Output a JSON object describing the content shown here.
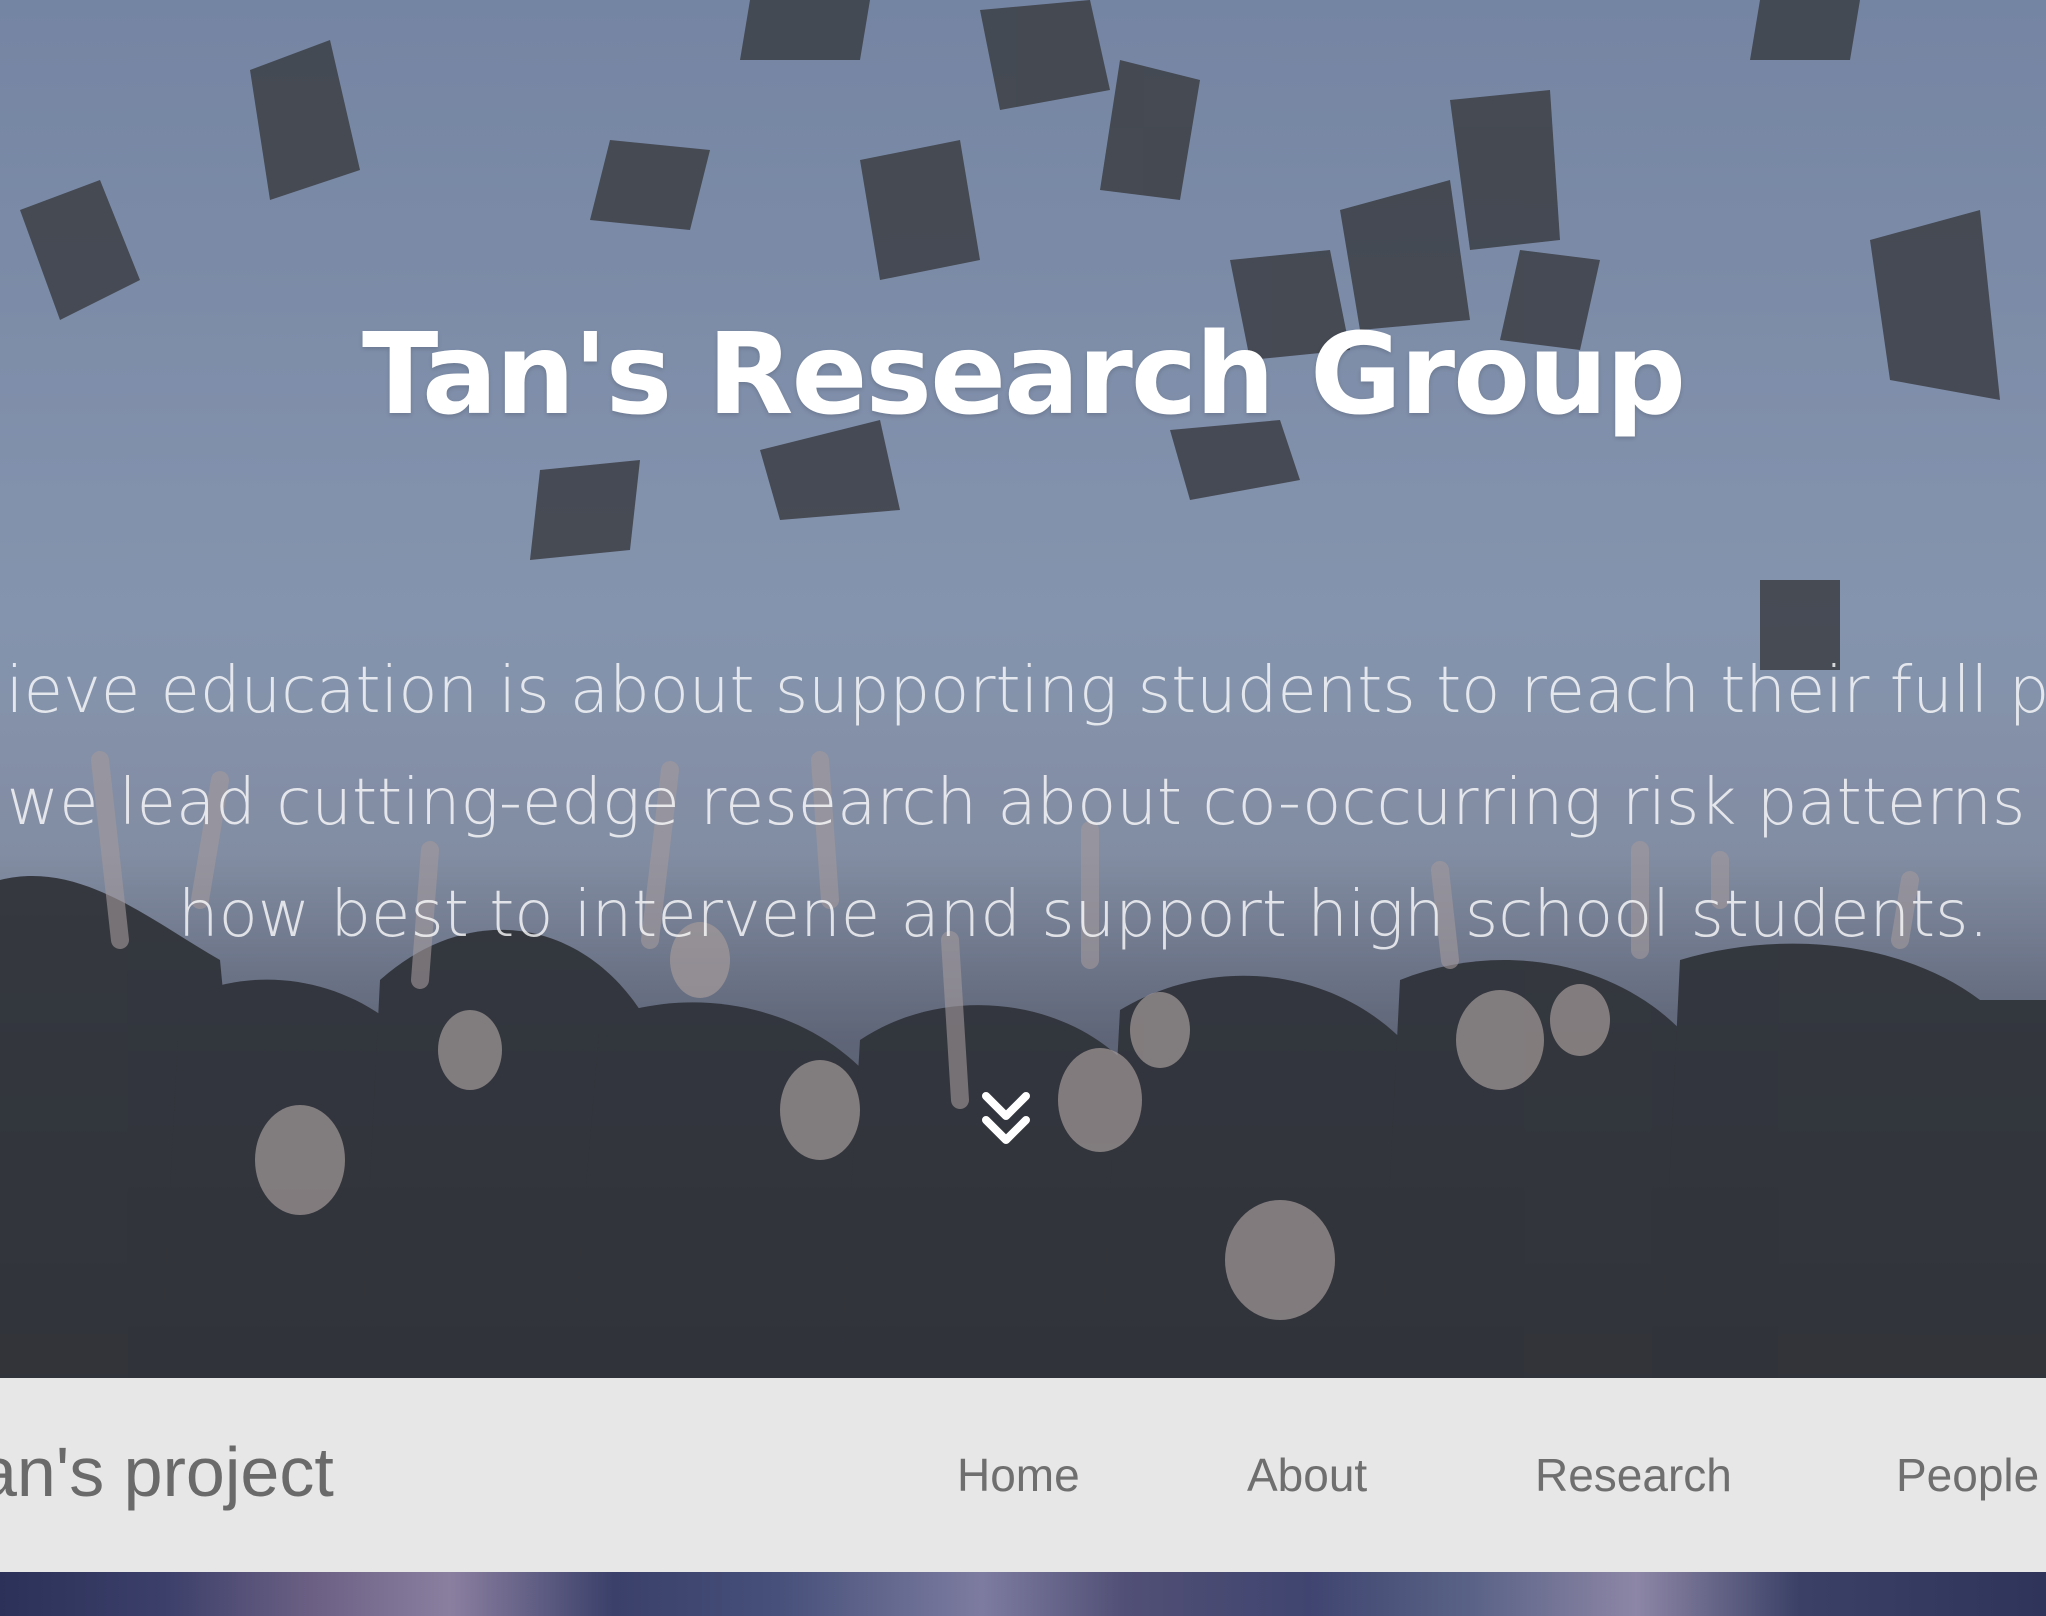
{
  "hero": {
    "title": "Tan's Research Group",
    "tagline_lines": [
      "believe education is about supporting students to reach their full potent",
      "hy we lead cutting-edge research about co-occurring risk patterns to i",
      "how best to intervene and support high school students."
    ],
    "scroll_icon": "double-chevron-down-icon"
  },
  "navbar": {
    "brand": "an's project",
    "items": [
      {
        "label": "Home"
      },
      {
        "label": "About"
      },
      {
        "label": "Research"
      },
      {
        "label": "People"
      }
    ]
  }
}
